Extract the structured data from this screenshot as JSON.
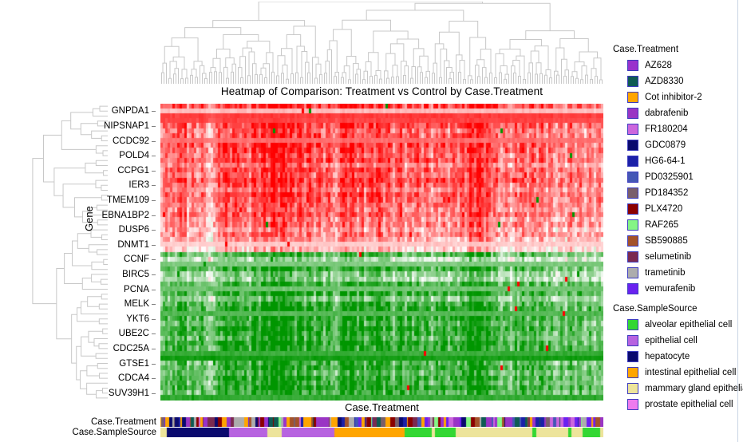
{
  "title": "Heatmap of Comparison: Treatment vs Control by Case.Treatment",
  "axes": {
    "x_label": "Case.Treatment",
    "y_label": "Gene"
  },
  "gene_labels": [
    "GNPDA1",
    "NIPSNAP1",
    "CCDC92",
    "POLD4",
    "CCPG1",
    "IER3",
    "TMEM109",
    "EBNA1BP2",
    "DUSP6",
    "DNMT1",
    "CCNF",
    "BIRC5",
    "PCNA",
    "MELK",
    "YKT6",
    "UBE2C",
    "CDC25A",
    "GTSE1",
    "CDCA4",
    "SUV39H1"
  ],
  "annotation_rows": [
    {
      "label": "Case.Treatment"
    },
    {
      "label": "Case.SampleSource"
    }
  ],
  "legend": {
    "groups": [
      {
        "title": "Case.Treatment",
        "items": [
          {
            "label": "AZ628",
            "color": "#9932CC"
          },
          {
            "label": "AZD8330",
            "color": "#0F5B53"
          },
          {
            "label": "Cot inhibitor-2",
            "color": "#FFA500"
          },
          {
            "label": "dabrafenib",
            "color": "#9A35C4"
          },
          {
            "label": "FR180204",
            "color": "#CC66DD"
          },
          {
            "label": "GDC0879",
            "color": "#0A0A6E"
          },
          {
            "label": "HG6-64-1",
            "color": "#1B20A8"
          },
          {
            "label": "PD0325901",
            "color": "#4457B5"
          },
          {
            "label": "PD184352",
            "color": "#7A5F6B"
          },
          {
            "label": "PLX4720",
            "color": "#8B0000"
          },
          {
            "label": "RAF265",
            "color": "#85F585"
          },
          {
            "label": "SB590885",
            "color": "#A4522A"
          },
          {
            "label": "selumetinib",
            "color": "#7B2A50"
          },
          {
            "label": "trametinib",
            "color": "#ADADAD"
          },
          {
            "label": "vemurafenib",
            "color": "#6A21F0"
          }
        ]
      },
      {
        "title": "Case.SampleSource",
        "items": [
          {
            "label": "alveolar epithelial cell",
            "color": "#33D733"
          },
          {
            "label": "epithelial cell",
            "color": "#B763E0"
          },
          {
            "label": "hepatocyte",
            "color": "#0A0A6E"
          },
          {
            "label": "intestinal epithelial cell",
            "color": "#FFA500"
          },
          {
            "label": "mammary gland epithelial",
            "color": "#EDE49B"
          },
          {
            "label": "prostate epithelial cell",
            "color": "#EE7BEE"
          }
        ]
      }
    ]
  },
  "colorscale": {
    "low": "#00A000",
    "mid": "#FFFFFF",
    "high": "#FF0000"
  },
  "chart_data": {
    "type": "heatmap",
    "title": "Heatmap of Comparison: Treatment vs Control by Case.Treatment",
    "xlabel": "Case.Treatment",
    "ylabel": "Gene",
    "n_columns": 185,
    "n_rows": 60,
    "row_tick_labels": [
      "GNPDA1",
      "NIPSNAP1",
      "CCDC92",
      "POLD4",
      "CCPG1",
      "IER3",
      "TMEM109",
      "EBNA1BP2",
      "DUSP6",
      "DNMT1",
      "CCNF",
      "BIRC5",
      "PCNA",
      "MELK",
      "YKT6",
      "UBE2C",
      "CDC25A",
      "GTSE1",
      "CDCA4",
      "SUV39H1"
    ],
    "value_range": [
      -3,
      3
    ],
    "colormap": "green-white-red",
    "grid": false,
    "legend_position": "right",
    "row_dendrogram": true,
    "column_dendrogram": true,
    "row_band_means": [
      1.55,
      0.4,
      1.3,
      1.25,
      1.45,
      1.05,
      1.2,
      0.95,
      1.5,
      1.35,
      1.15,
      1.4,
      0.85,
      1.3,
      1.1,
      1.45,
      1.25,
      0.95,
      1.35,
      1.15,
      1.05,
      0.9,
      1.2,
      0.75,
      0.95,
      0.6,
      0.85,
      0.45,
      0.3,
      0.1,
      -1.3,
      -0.35,
      -0.95,
      -1.55,
      -0.75,
      -0.55,
      -1.45,
      -1.05,
      -1.6,
      -0.85,
      -1.5,
      -1.7,
      -1.25,
      -1.65,
      -1.4,
      -1.75,
      -1.55,
      -1.3,
      -1.8,
      -1.6,
      -1.45,
      -1.7,
      -1.35,
      -1.55,
      -1.25,
      -1.6,
      -1.4,
      -1.7,
      -1.3,
      -1.5
    ],
    "column_band_means": [
      0.15,
      0.35,
      0.55,
      0.3,
      0.45,
      0.6,
      0.25,
      0.5,
      0.7,
      0.4,
      0.65,
      0.2,
      0.45,
      0.75,
      0.55,
      0.3,
      0.6,
      0.8,
      0.5,
      0.35,
      -0.6,
      -0.8,
      -0.45,
      0.25,
      0.55,
      0.4,
      0.7,
      0.9,
      0.6,
      0.45,
      0.8,
      1.0,
      0.75,
      0.55,
      0.85,
      1.05,
      0.7,
      0.5,
      0.9,
      1.1,
      0.65,
      0.45,
      0.95,
      1.15,
      0.8,
      0.6,
      1.0,
      1.2,
      0.85,
      0.65,
      1.05,
      1.25,
      0.9,
      0.7,
      1.1,
      0.85,
      0.55,
      0.95,
      1.15,
      0.75,
      0.45,
      0.85,
      1.05,
      0.65,
      0.35,
      0.75,
      0.95,
      0.55,
      0.25,
      0.65,
      0.85,
      0.45,
      0.15,
      -0.25,
      0.35,
      0.75,
      1.05,
      0.85,
      0.55,
      0.95,
      1.15,
      0.75,
      0.45,
      0.85,
      1.05,
      0.65,
      0.95,
      1.2,
      0.8,
      0.5,
      0.9,
      1.1,
      0.7,
      0.4,
      0.8,
      1.0,
      0.6,
      0.3,
      0.7,
      0.9,
      1.1,
      0.85,
      0.55,
      0.95,
      1.15,
      0.75,
      1.05,
      1.25,
      0.9,
      0.6,
      1.0,
      1.2,
      0.8,
      0.5,
      0.9,
      1.1,
      0.7,
      1.0,
      1.2,
      0.85,
      0.55,
      0.95,
      1.15,
      0.75,
      0.45,
      0.85,
      1.05,
      0.65,
      0.95,
      1.15,
      0.8,
      0.5,
      0.9,
      1.1,
      0.7,
      0.4,
      0.8,
      1.0,
      0.6,
      0.9,
      1.1,
      0.75,
      0.45,
      0.85,
      1.05,
      0.65,
      0.35,
      0.75,
      0.95,
      0.55,
      0.85,
      1.05,
      0.7,
      0.4,
      0.8,
      1.0,
      0.6,
      0.3,
      0.7,
      0.9,
      0.5,
      0.2,
      0.6,
      0.8,
      0.45,
      0.15,
      0.55,
      0.75,
      0.4,
      0.1,
      0.5,
      0.7,
      0.35,
      0.05,
      0.45,
      0.65,
      0.3,
      0.0,
      0.4,
      0.6,
      0.25,
      -0.1,
      0.35,
      0.55,
      0.2
    ]
  }
}
